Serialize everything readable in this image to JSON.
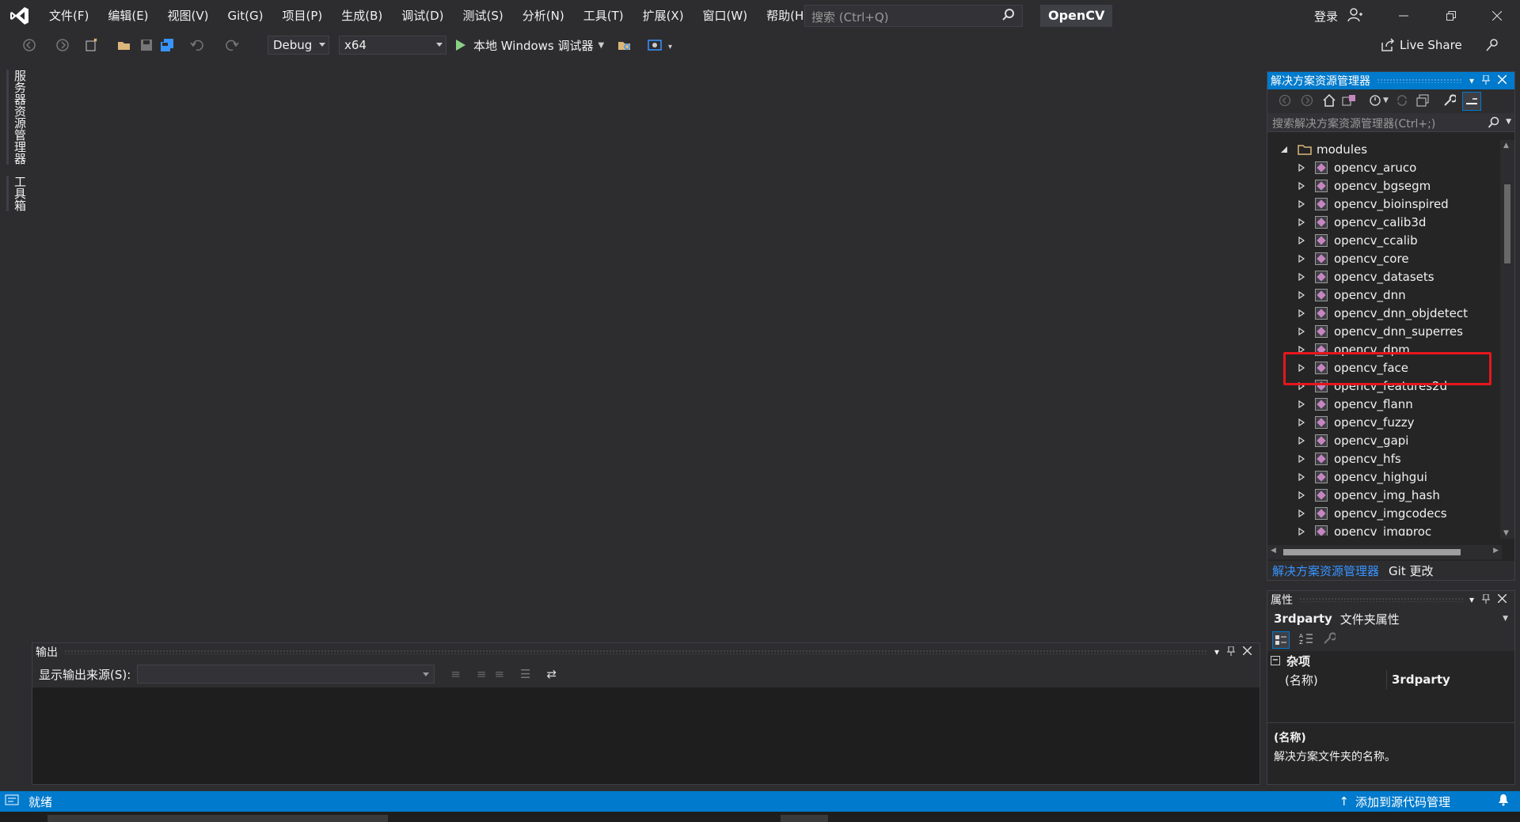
{
  "menu": [
    "文件(F)",
    "编辑(E)",
    "视图(V)",
    "Git(G)",
    "项目(P)",
    "生成(B)",
    "调试(D)",
    "测试(S)",
    "分析(N)",
    "工具(T)",
    "扩展(X)",
    "窗口(W)",
    "帮助(H)"
  ],
  "search": {
    "placeholder": "搜索 (Ctrl+Q)"
  },
  "solution_name": "OpenCV",
  "login": "登录",
  "toolbar": {
    "config": "Debug",
    "platform": "x64",
    "run_label": "本地 Windows 调试器",
    "live_share": "Live Share"
  },
  "left_tabs": [
    "服务器资源管理器",
    "工具箱"
  ],
  "output": {
    "title": "输出",
    "source_label": "显示输出来源(S):",
    "source_value": ""
  },
  "solution_explorer": {
    "title": "解决方案资源管理器",
    "search_placeholder": "搜索解决方案资源管理器(Ctrl+;)",
    "root": "modules",
    "items": [
      "opencv_aruco",
      "opencv_bgsegm",
      "opencv_bioinspired",
      "opencv_calib3d",
      "opencv_ccalib",
      "opencv_core",
      "opencv_datasets",
      "opencv_dnn",
      "opencv_dnn_objdetect",
      "opencv_dnn_superres",
      "opencv_dpm",
      "opencv_face",
      "opencv_features2d",
      "opencv_flann",
      "opencv_fuzzy",
      "opencv_gapi",
      "opencv_hfs",
      "opencv_highgui",
      "opencv_img_hash",
      "opencv_imgcodecs",
      "opencv_imgproc"
    ],
    "highlighted_item": "opencv_face",
    "tabs": [
      "解决方案资源管理器",
      "Git 更改"
    ]
  },
  "properties": {
    "title": "属性",
    "object_name": "3rdparty",
    "object_type": "文件夹属性",
    "category": "杂项",
    "rows": [
      {
        "name": "(名称)",
        "value": "3rdparty"
      }
    ],
    "desc_title": "(名称)",
    "desc_text": "解决方案文件夹的名称。"
  },
  "status": {
    "text": "就绪",
    "right_text": "添加到源代码管理"
  },
  "colors": {
    "accent": "#007acc",
    "highlight_box": "#e5171c"
  }
}
